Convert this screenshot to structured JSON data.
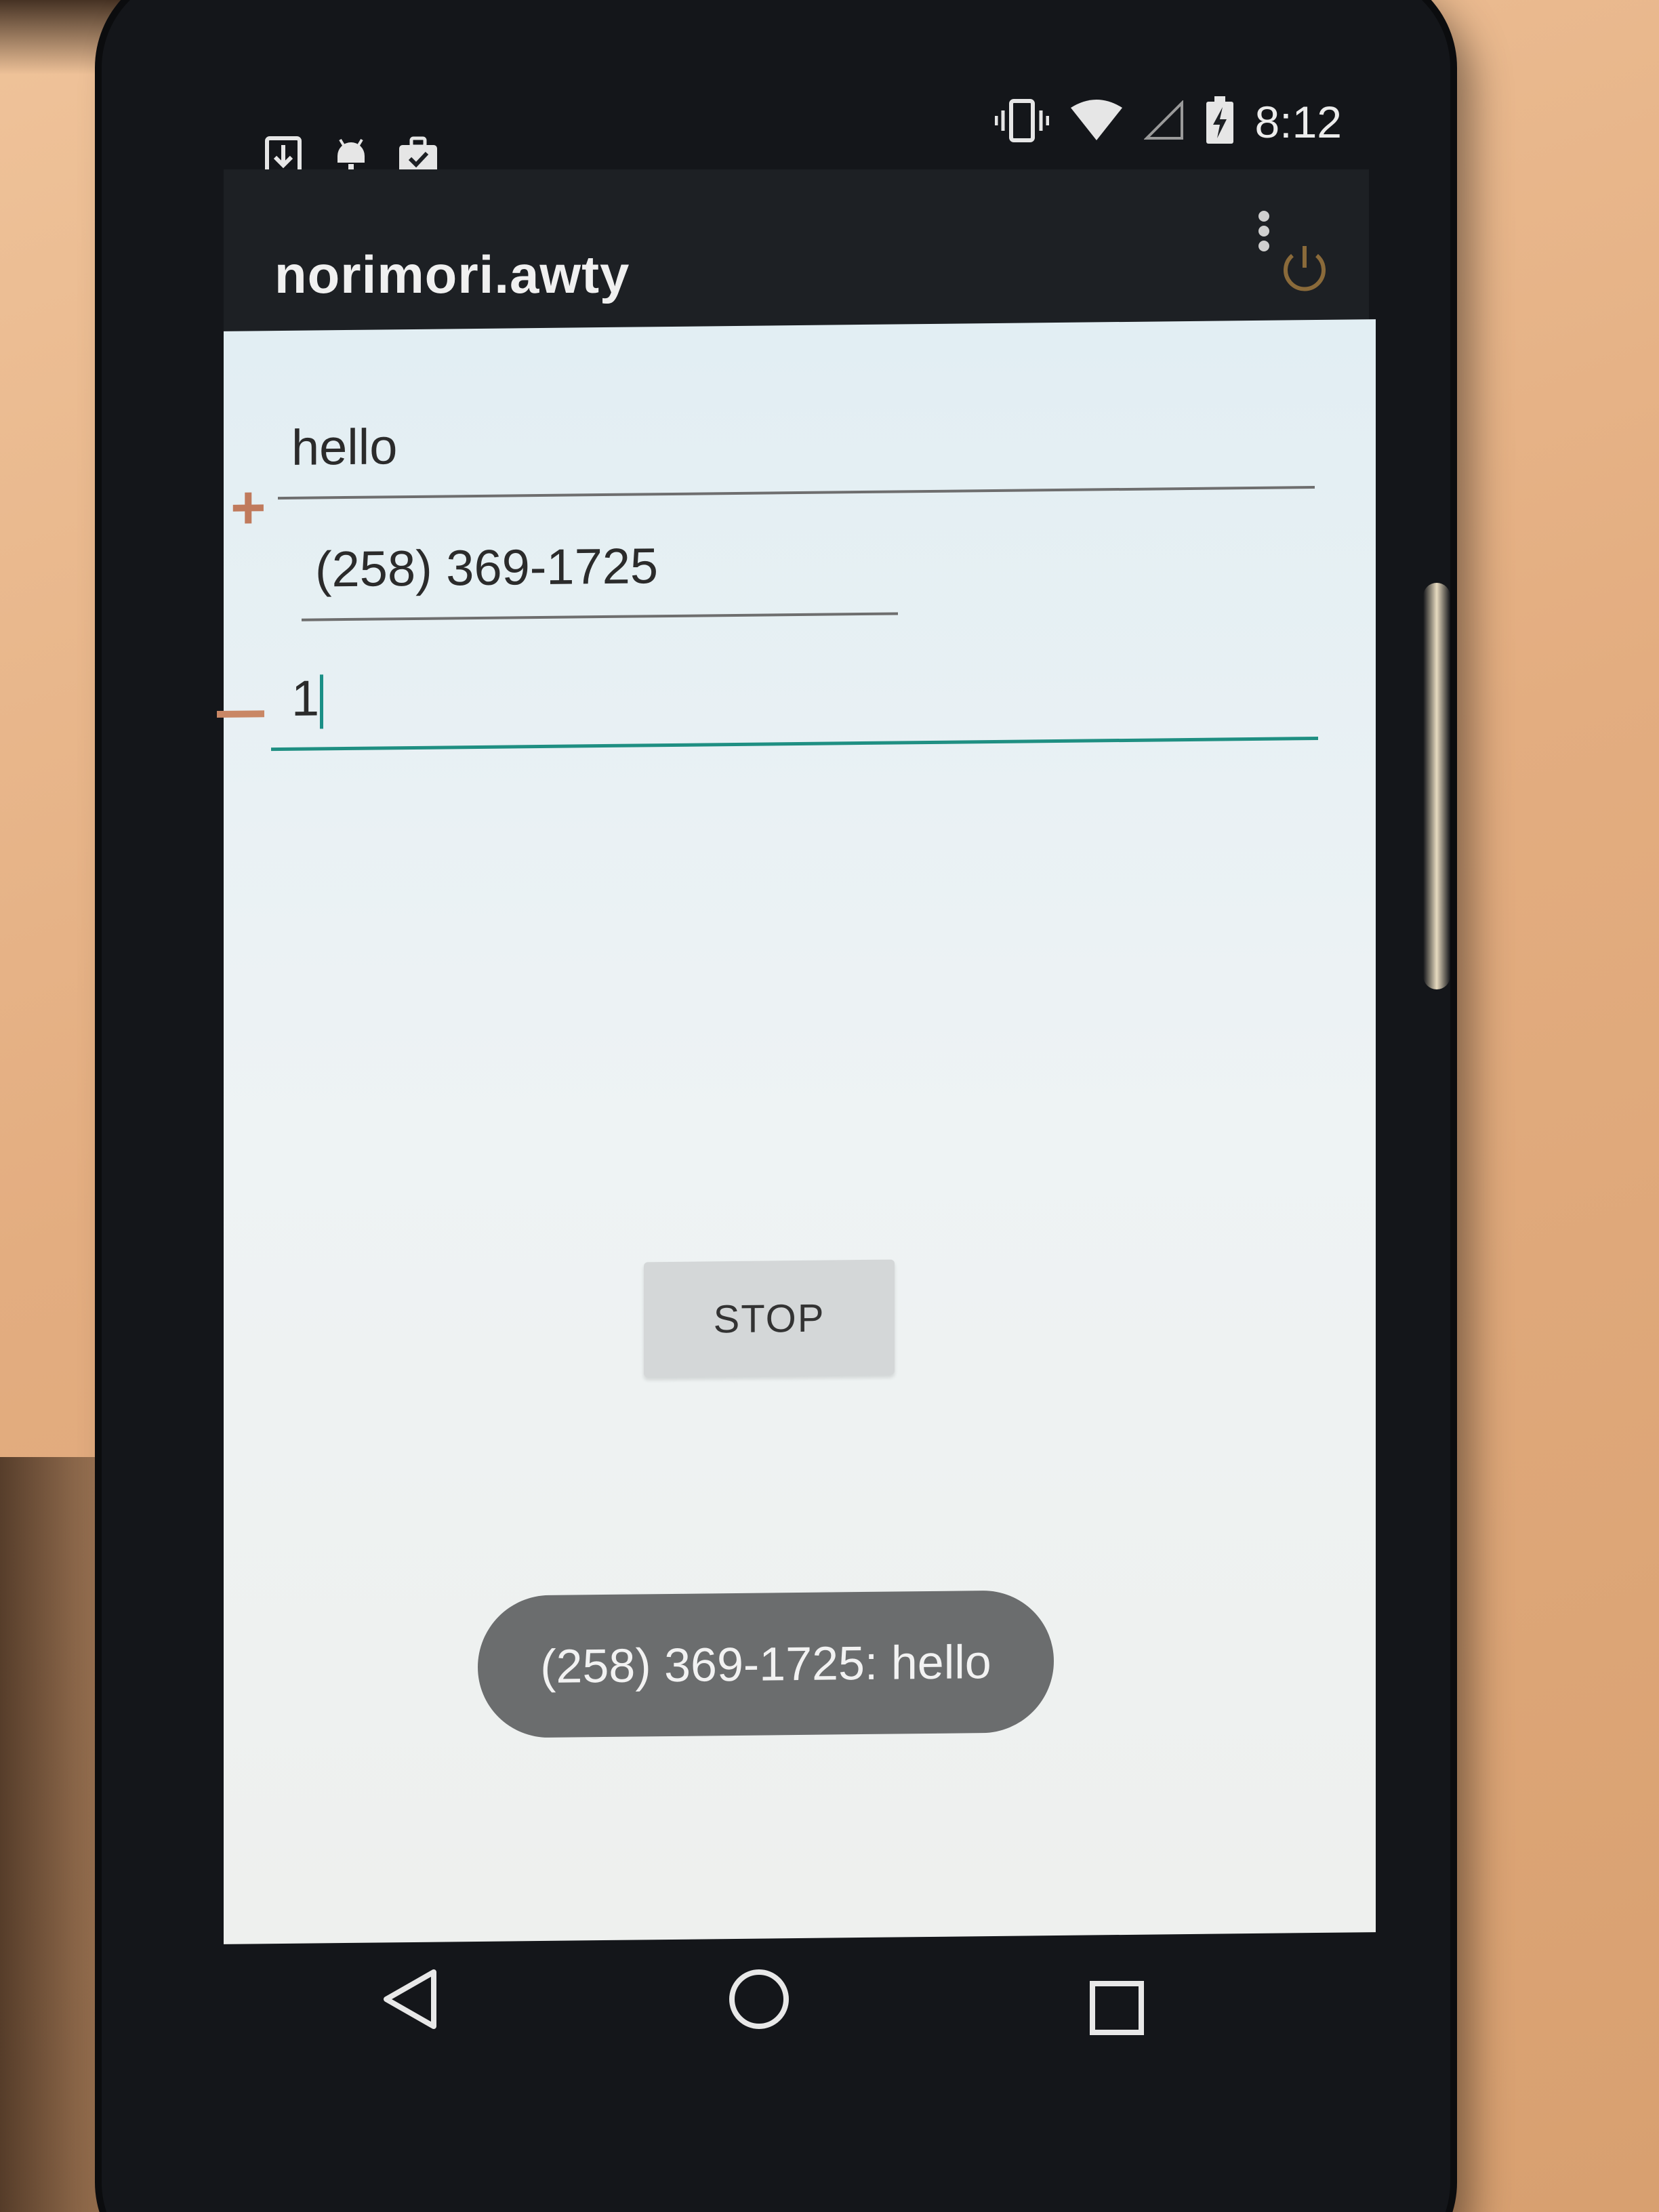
{
  "status_bar": {
    "clock": "8:12",
    "left_icons": [
      "download-icon",
      "android-debug-icon",
      "briefcase-icon"
    ],
    "right_icons": [
      "vibrate-icon",
      "wifi-icon",
      "signal-icon",
      "battery-charging-icon"
    ]
  },
  "app_bar": {
    "title": "norimori.awty",
    "overflow_icon": "more-vertical-icon",
    "power_icon": "power-icon"
  },
  "form": {
    "message_value": "hello",
    "phone_value": "(258) 369-1725",
    "interval_value": "1",
    "plus_symbol": "+",
    "accent_color": "#1f8f82"
  },
  "actions": {
    "stop_label": "STOP"
  },
  "toast": {
    "text": "(258) 369-1725: hello"
  },
  "nav_bar": {
    "icons": [
      "back-icon",
      "home-icon",
      "recents-icon"
    ]
  }
}
